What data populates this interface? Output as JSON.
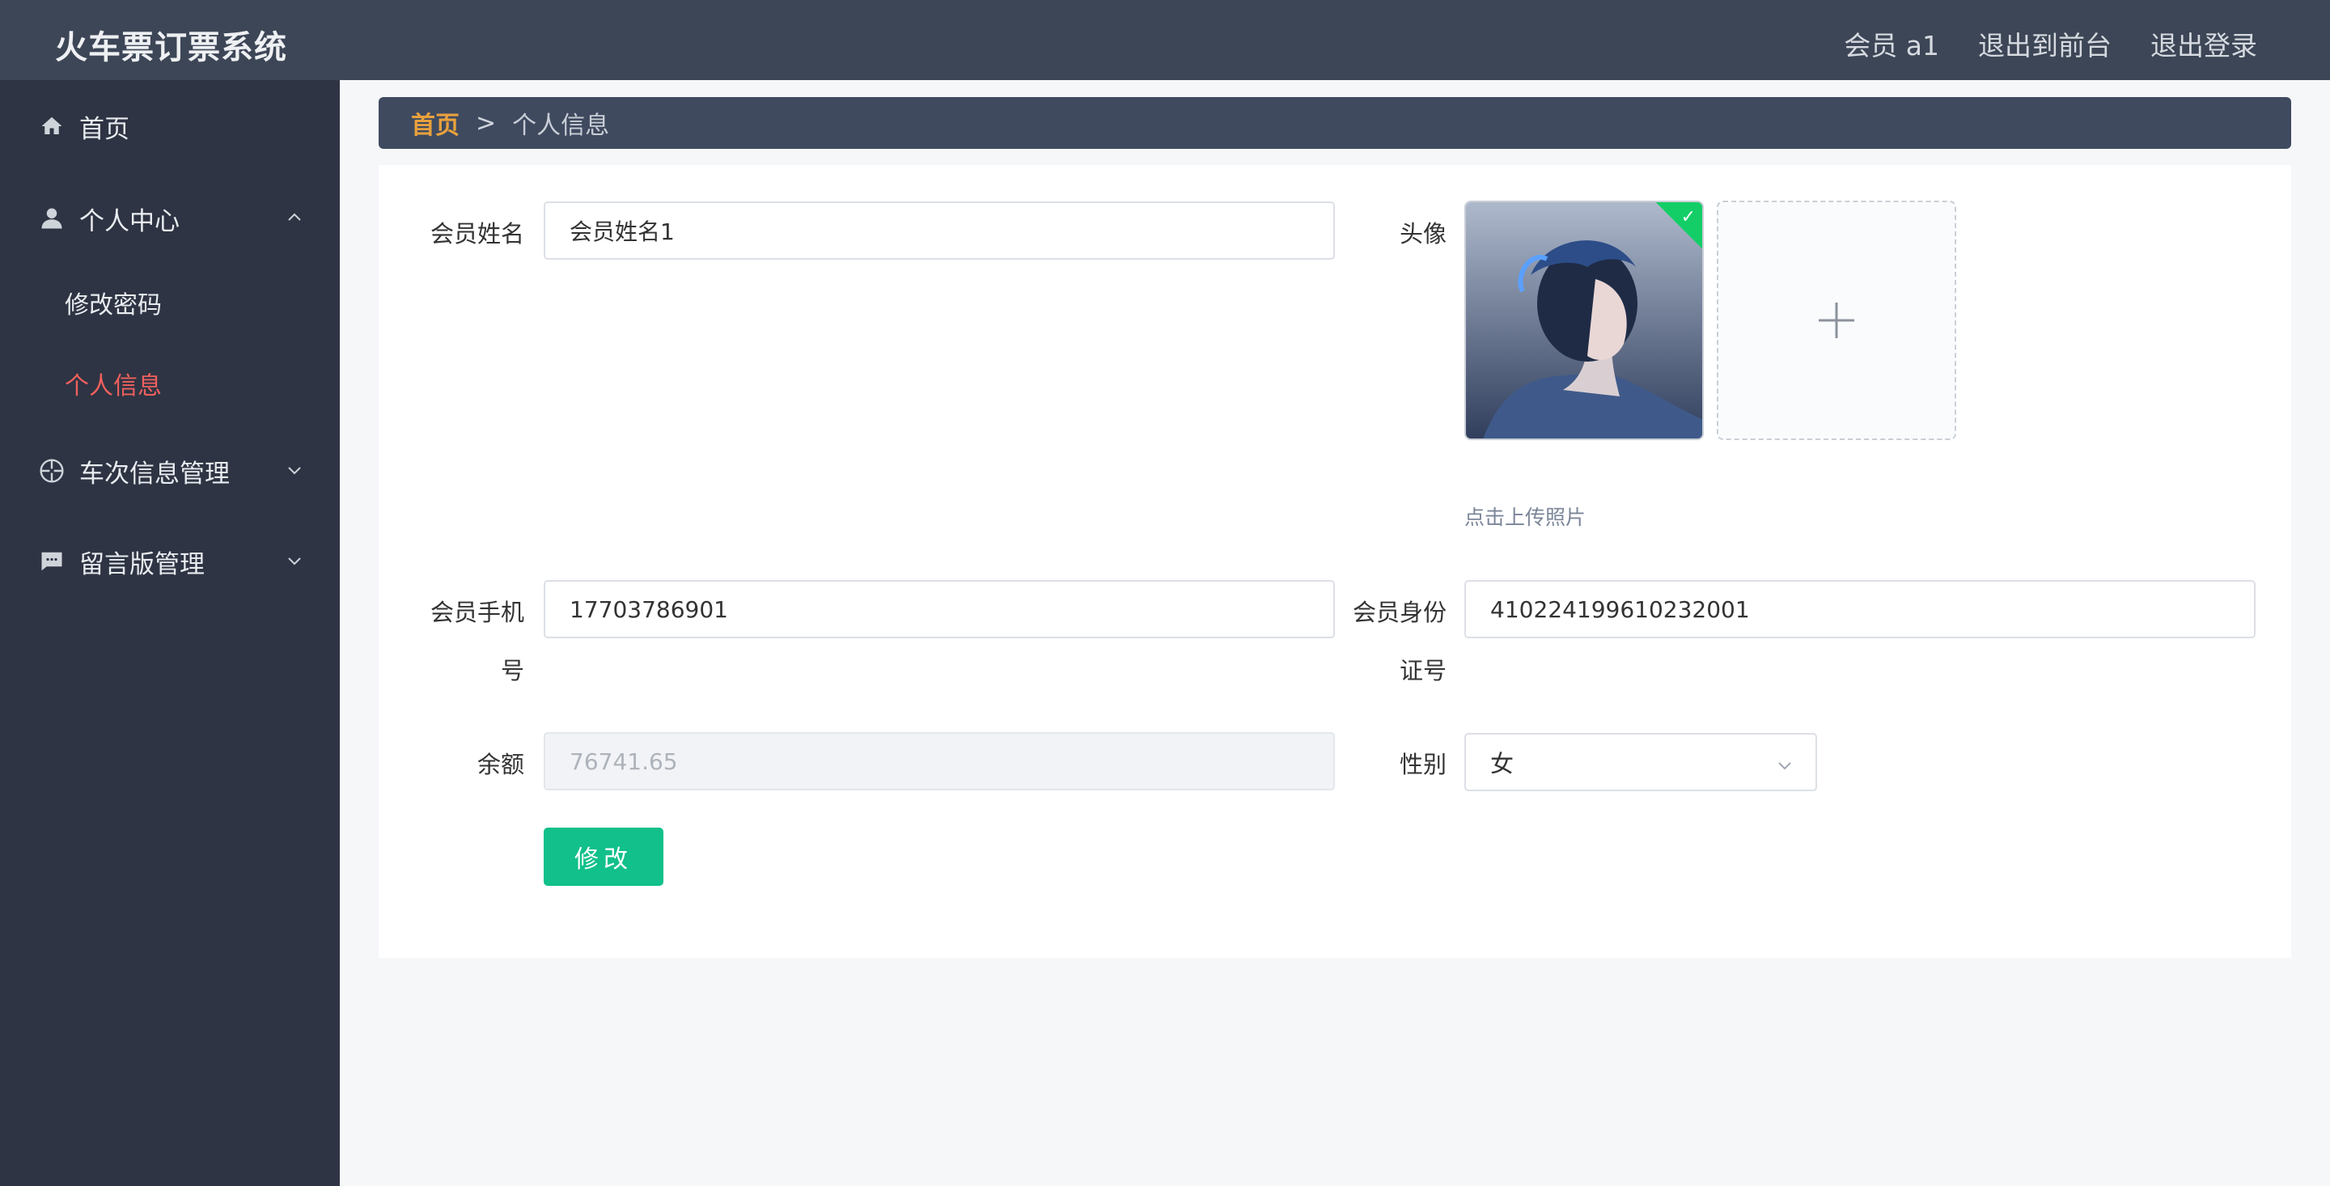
{
  "app": {
    "title": "火车票订票系统"
  },
  "topnav": {
    "user_label": "会员 a1",
    "to_frontend": "退出到前台",
    "logout": "退出登录"
  },
  "sidebar": {
    "items": [
      {
        "label": "首页",
        "icon": "home-icon"
      },
      {
        "label": "个人中心",
        "icon": "user-icon",
        "expanded": true,
        "children": [
          {
            "label": "修改密码"
          },
          {
            "label": "个人信息",
            "active": true
          }
        ]
      },
      {
        "label": "车次信息管理",
        "icon": "crosshair-icon",
        "expanded": false
      },
      {
        "label": "留言版管理",
        "icon": "message-icon",
        "expanded": false
      }
    ]
  },
  "breadcrumb": {
    "home": "首页",
    "separator": ">",
    "current": "个人信息"
  },
  "form": {
    "name_label": "会员姓名",
    "name_value": "会员姓名1",
    "avatar_label": "头像",
    "upload_tip": "点击上传照片",
    "phone_label_1": "会员手机",
    "phone_label_2": "号",
    "phone_value": "17703786901",
    "idcard_label_1": "会员身份",
    "idcard_label_2": "证号",
    "idcard_value": "410224199610232001",
    "balance_label": "余额",
    "balance_value": "76741.65",
    "gender_label": "性别",
    "gender_value": "女",
    "submit_label": "修改"
  },
  "colors": {
    "header_bg": "#3d4656",
    "sidebar_bg": "#2e3443",
    "active_menu": "#f0605e",
    "breadcrumb_home": "#e9a13d",
    "primary_button": "#11c08a"
  }
}
